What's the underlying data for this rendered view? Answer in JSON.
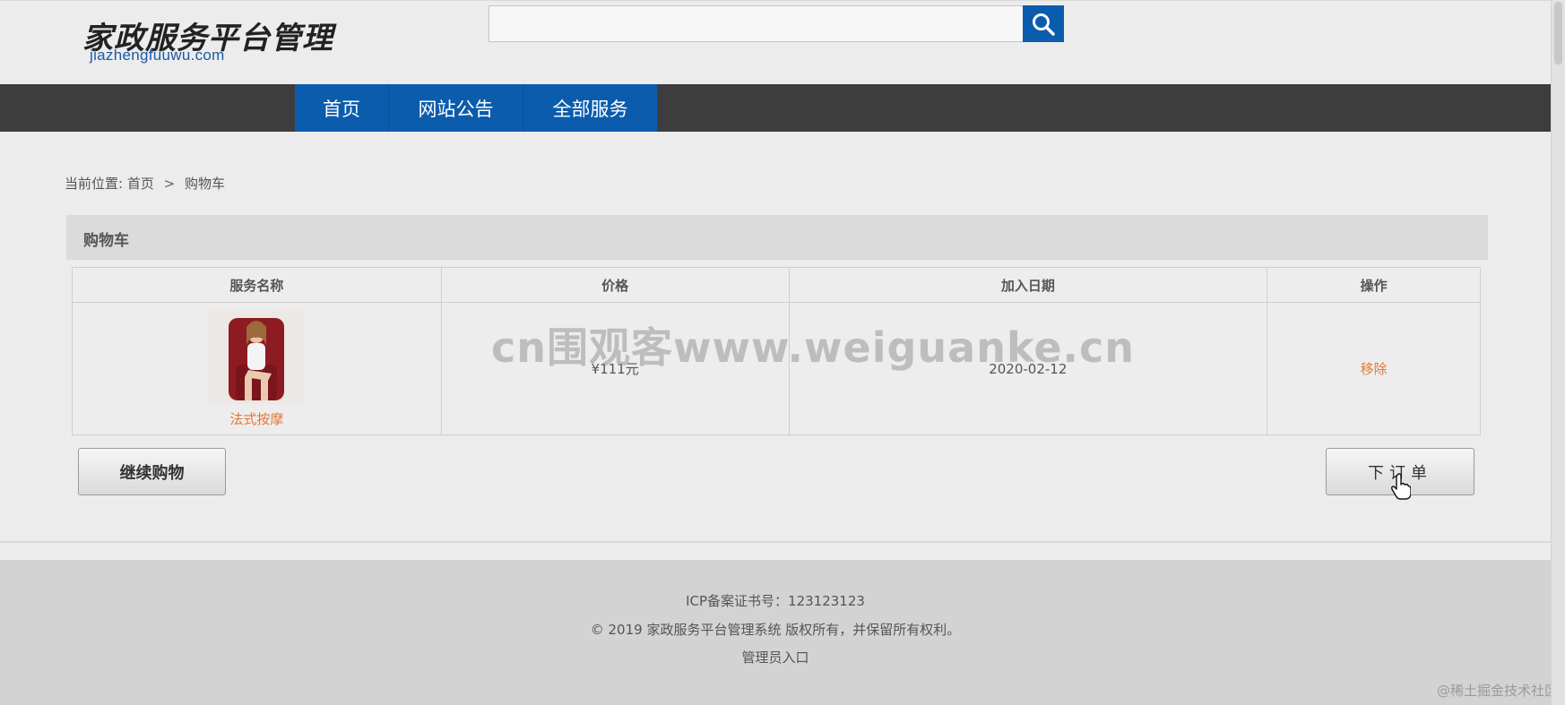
{
  "header": {
    "logo_cn": "家政服务平台管理",
    "logo_en": "jiazhengfuuwu.com",
    "search": {
      "placeholder": "",
      "value": "",
      "button_icon": "search-icon"
    }
  },
  "nav": {
    "items": [
      {
        "label": "首页"
      },
      {
        "label": "网站公告"
      },
      {
        "label": "全部服务"
      }
    ]
  },
  "breadcrumb": {
    "prefix": "当前位置:",
    "home": "首页",
    "separator": ">",
    "current": "购物车"
  },
  "cart": {
    "title": "购物车",
    "columns": [
      "服务名称",
      "价格",
      "加入日期",
      "操作"
    ],
    "rows": [
      {
        "service_name": "法式按摩",
        "price": "¥111元",
        "date": "2020-02-12",
        "action": "移除"
      }
    ],
    "continue_label": "继续购物",
    "order_label": "下订单"
  },
  "watermark": "cn围观客www.weiguanke.cn",
  "footer": {
    "icp": "ICP备案证书号：123123123",
    "copyright": "© 2019 家政服务平台管理系统 版权所有，并保留所有权利。",
    "admin_link": "管理员入口"
  },
  "corner_mark": "@稀土掘金技术社区",
  "colors": {
    "primary_blue": "#0b5cad",
    "nav_bg": "#3d3d3d",
    "link_orange": "#e8772e",
    "page_bg": "#ececec",
    "footer_bg": "#d3d3d3"
  }
}
